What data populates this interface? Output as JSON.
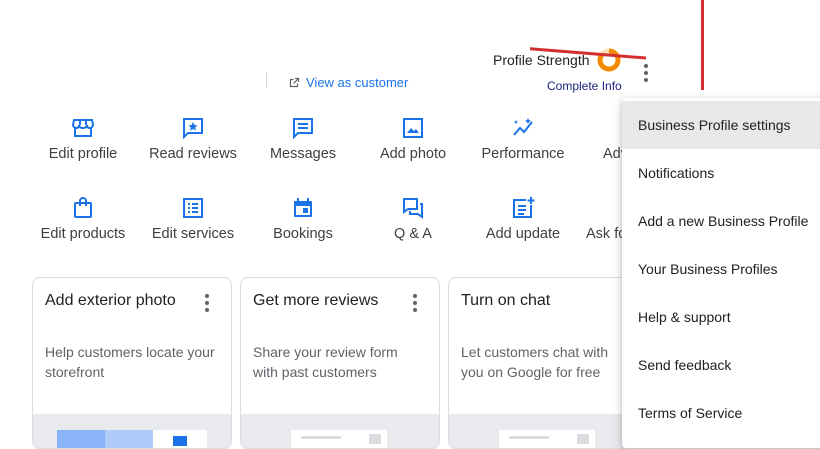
{
  "header": {
    "view_as_customer": "View as customer",
    "profile_strength_label": "Profile Strength",
    "complete_info": "Complete Info",
    "profile_strength_fraction": 0.85,
    "accent_color": "#1a73e8",
    "strength_color": "#f28b00"
  },
  "actions_row1": [
    {
      "label": "Edit profile",
      "icon": "storefront-icon"
    },
    {
      "label": "Read reviews",
      "icon": "star-review-icon"
    },
    {
      "label": "Messages",
      "icon": "message-icon"
    },
    {
      "label": "Add photo",
      "icon": "photo-icon"
    },
    {
      "label": "Performance",
      "icon": "performance-icon"
    },
    {
      "label": "Adv",
      "icon": "ads-icon"
    }
  ],
  "actions_row2": [
    {
      "label": "Edit products",
      "icon": "shopping-bag-icon"
    },
    {
      "label": "Edit services",
      "icon": "list-icon"
    },
    {
      "label": "Bookings",
      "icon": "calendar-icon"
    },
    {
      "label": "Q & A",
      "icon": "qa-icon"
    },
    {
      "label": "Add update",
      "icon": "post-add-icon"
    },
    {
      "label": "Ask fo",
      "icon": "ask-icon"
    }
  ],
  "cards": [
    {
      "title": "Add exterior photo",
      "description": "Help customers locate your storefront"
    },
    {
      "title": "Get more reviews",
      "description": "Share your review form with past customers"
    },
    {
      "title": "Turn on chat",
      "description": "Let customers chat with you on Google for free"
    }
  ],
  "menu": {
    "items": [
      "Business Profile settings",
      "Notifications",
      "Add a new Business Profile",
      "Your Business Profiles",
      "Help & support",
      "Send feedback",
      "Terms of Service"
    ],
    "active_index": 0
  }
}
